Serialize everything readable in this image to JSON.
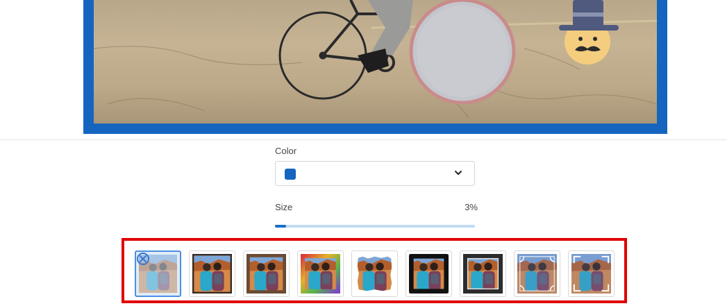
{
  "canvas": {
    "frame_color": "#1565c0",
    "photo_description_icons": [
      "bicycle-icon",
      "circle-sticker-icon",
      "hat-mustache-sticker-icon"
    ]
  },
  "controls": {
    "color_label": "Color",
    "color_value": "#1565c0",
    "size_label": "Size",
    "size_value": "3%",
    "size_fraction": 0.03
  },
  "frames": {
    "highlight_color": "#e00000",
    "items": [
      {
        "name": "frame-none",
        "style": "none"
      },
      {
        "name": "frame-white-thin",
        "style": "white"
      },
      {
        "name": "frame-brown",
        "style": "brown"
      },
      {
        "name": "frame-rainbow",
        "style": "rainbow"
      },
      {
        "name": "frame-torn-white",
        "style": "torn"
      },
      {
        "name": "frame-black-vignette",
        "style": "black"
      },
      {
        "name": "frame-dark-gray",
        "style": "darkgray"
      },
      {
        "name": "frame-ornament",
        "style": "ornament"
      },
      {
        "name": "frame-corners",
        "style": "corners"
      }
    ]
  }
}
